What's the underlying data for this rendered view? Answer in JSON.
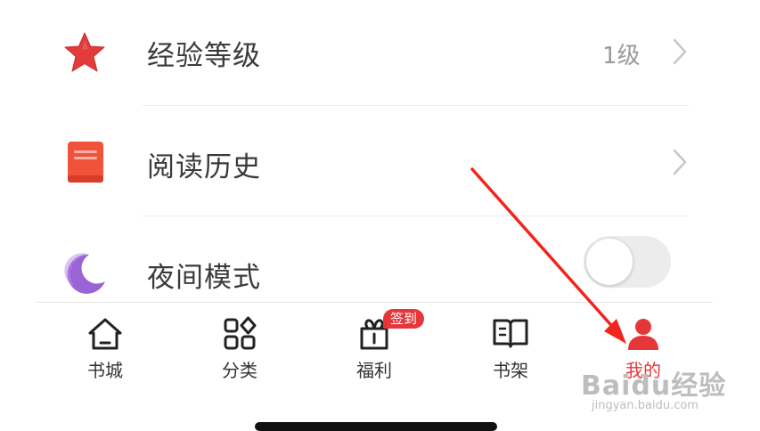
{
  "settings": {
    "items": [
      {
        "label": "经验等级",
        "value": "1级",
        "icon": "star-icon",
        "icon_color": "#e33b3b"
      },
      {
        "label": "阅读历史",
        "icon": "book-icon",
        "icon_color": "#f0533a"
      },
      {
        "label": "夜间模式",
        "icon": "moon-icon",
        "icon_color": "#9a63d6",
        "toggle_on": false
      }
    ]
  },
  "tabbar": {
    "items": [
      {
        "label": "书城",
        "icon": "home-icon"
      },
      {
        "label": "分类",
        "icon": "category-icon"
      },
      {
        "label": "福利",
        "icon": "gift-icon",
        "badge": "签到"
      },
      {
        "label": "书架",
        "icon": "bookshelf-icon"
      },
      {
        "label": "我的",
        "icon": "user-icon",
        "active": true
      }
    ]
  },
  "watermark": {
    "main": "Baidu经验",
    "sub": "jingyan.baidu.com"
  },
  "colors": {
    "accent": "#e5373a",
    "annotation_arrow": "#f0251c"
  }
}
